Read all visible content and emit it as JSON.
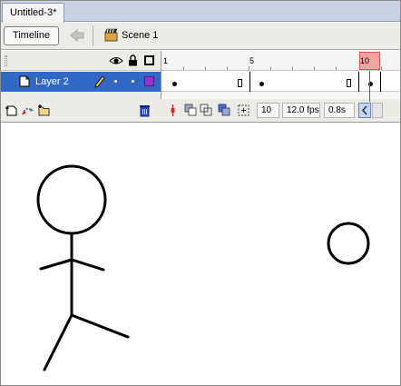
{
  "document": {
    "tab_title": "Untitled-3*"
  },
  "editbar": {
    "timeline_label": "Timeline",
    "scene_label": "Scene 1"
  },
  "ruler": {
    "labels": [
      "1",
      "5",
      "10"
    ],
    "current_frame": 10
  },
  "layer": {
    "name": "Layer 2",
    "color": "#9a33cc"
  },
  "status": {
    "frame": "10",
    "fps": "12.0 fps",
    "time": "0.8s"
  },
  "colors": {
    "selection": "#3167c5",
    "playhead": "#f4a3a3",
    "panel": "#ecebe6",
    "tab_bar": "#c9d2e3"
  },
  "icons": [
    "eye-icon",
    "lock-icon",
    "outline-icon",
    "layer-icon",
    "pencil-icon",
    "scene-icon",
    "back-arrow-icon",
    "trash-icon",
    "add-layer-icon",
    "add-motion-guide-icon",
    "insert-folder-icon",
    "center-frame-icon",
    "onion-skin-icon",
    "onion-skin-outlines-icon",
    "edit-multiple-frames-icon",
    "modify-onion-markers-icon"
  ]
}
